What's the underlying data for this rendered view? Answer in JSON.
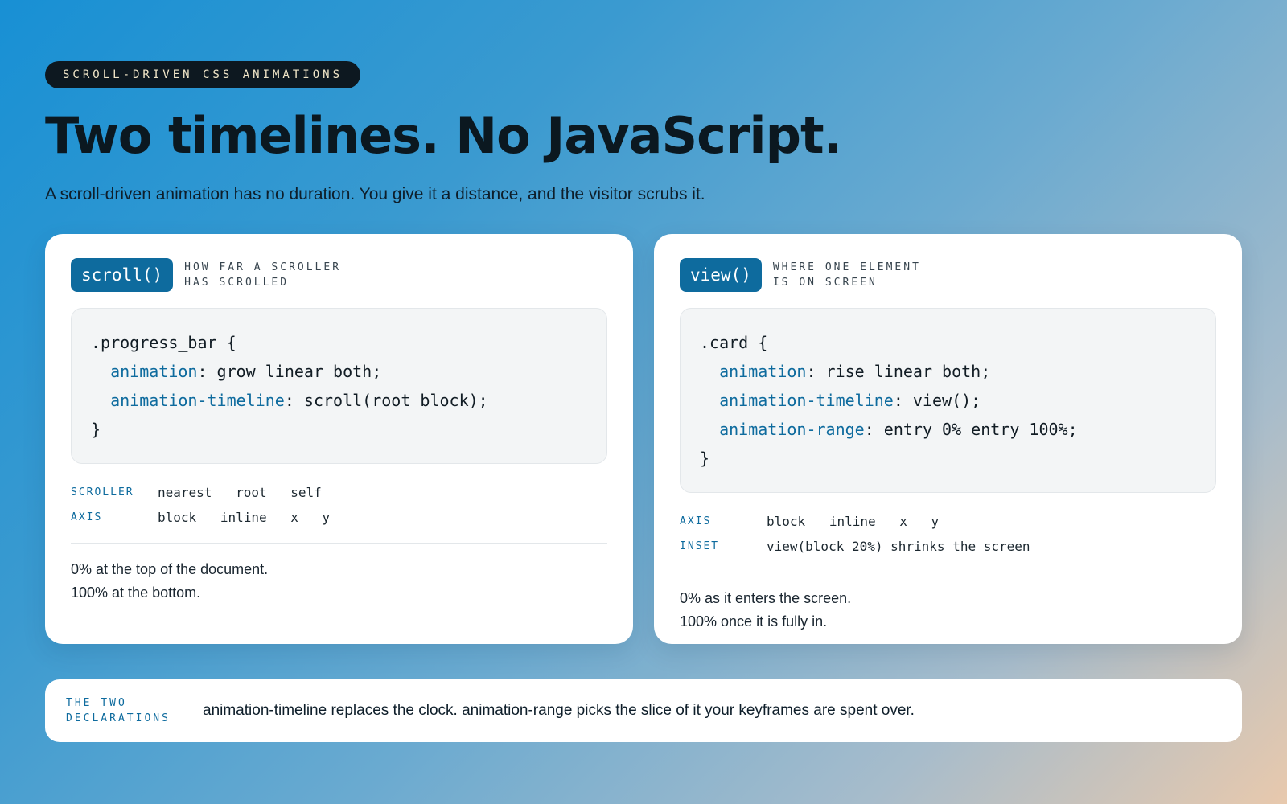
{
  "header": {
    "kicker": "SCROLL-DRIVEN CSS ANIMATIONS",
    "title": "Two timelines. No JavaScript.",
    "subtitle": "A scroll-driven animation has no duration. You give it a distance, and the visitor scrubs it."
  },
  "cards": [
    {
      "fn": "scroll()",
      "desc_line1": "HOW FAR A SCROLLER",
      "desc_line2": "HAS SCROLLED",
      "code": {
        "selector": ".progress_bar {",
        "lines": [
          {
            "prop": "animation",
            "value": ": grow linear both;"
          },
          {
            "prop": "animation-timeline",
            "value": ": scroll(root block);"
          }
        ],
        "close": "}"
      },
      "options": [
        {
          "key": "SCROLLER",
          "values": [
            "nearest",
            "root",
            "self"
          ]
        },
        {
          "key": "AXIS",
          "values": [
            "block",
            "inline",
            "x",
            "y"
          ]
        }
      ],
      "note_line1": "0% at the top of the document.",
      "note_line2": "100% at the bottom."
    },
    {
      "fn": "view()",
      "desc_line1": "WHERE ONE ELEMENT",
      "desc_line2": "IS ON SCREEN",
      "code": {
        "selector": ".card {",
        "lines": [
          {
            "prop": "animation",
            "value": ": rise linear both;"
          },
          {
            "prop": "animation-timeline",
            "value": ": view();"
          },
          {
            "prop": "animation-range",
            "value": ": entry 0% entry 100%;"
          }
        ],
        "close": "}"
      },
      "options": [
        {
          "key": "AXIS",
          "values": [
            "block",
            "inline",
            "x",
            "y"
          ]
        },
        {
          "key": "INSET",
          "values": [
            "view(block 20%) shrinks the screen"
          ]
        }
      ],
      "note_line1": "0% as it enters the screen.",
      "note_line2": "100% once it is fully in."
    }
  ],
  "footer": {
    "label_line1": "THE TWO",
    "label_line2": "DECLARATIONS",
    "text": "animation-timeline replaces the clock. animation-range picks the slice of it your keyframes are spent over."
  },
  "colors": {
    "accent": "#0e6b9e",
    "ink": "#0b1820",
    "kicker_bg": "#0d1820",
    "kicker_text": "#f1e6c8"
  }
}
